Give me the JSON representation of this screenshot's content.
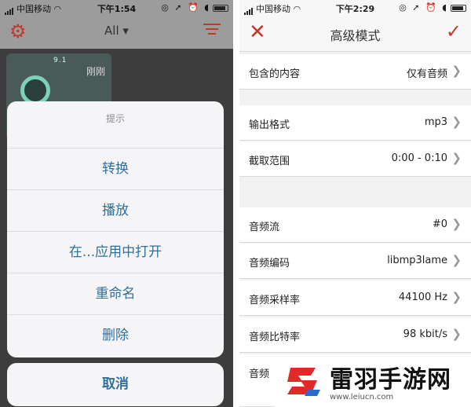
{
  "left_phone": {
    "status": {
      "carrier": "中国移动",
      "time": "下午1:54"
    },
    "header": {
      "filter_label": "All ▾"
    },
    "card": {
      "number": "9.1",
      "timestamp": "刚刚"
    },
    "action_sheet": {
      "title": "提示",
      "items": [
        "转换",
        "播放",
        "在...应用中打开",
        "重命名",
        "删除"
      ],
      "cancel": "取消"
    }
  },
  "right_phone": {
    "status": {
      "carrier": "中国移动",
      "time": "下午2:29"
    },
    "nav": {
      "title": "高级模式"
    },
    "settings": [
      {
        "label": "包含的内容",
        "value": "仅有音频"
      },
      {
        "label": "输出格式",
        "value": "mp3"
      },
      {
        "label": "截取范围",
        "value": "0:00 - 0:10"
      },
      {
        "label": "音频流",
        "value": "#0"
      },
      {
        "label": "音频编码",
        "value": "libmp3lame"
      },
      {
        "label": "音频采样率",
        "value": "44100 Hz"
      },
      {
        "label": "音频比特率",
        "value": "98 kbit/s"
      },
      {
        "label": "音频",
        "value": ""
      }
    ]
  },
  "watermark": {
    "title": "雷羽手游网",
    "url": "www.leiucn.com"
  },
  "colors": {
    "accent": "#c0392b",
    "sheet_text": "#2e6f9e"
  },
  "icons": {
    "settings": "gear-icon",
    "filter": "filter-icon",
    "close": "close-icon",
    "confirm": "check-icon",
    "chevron": "chevron-right-icon"
  }
}
